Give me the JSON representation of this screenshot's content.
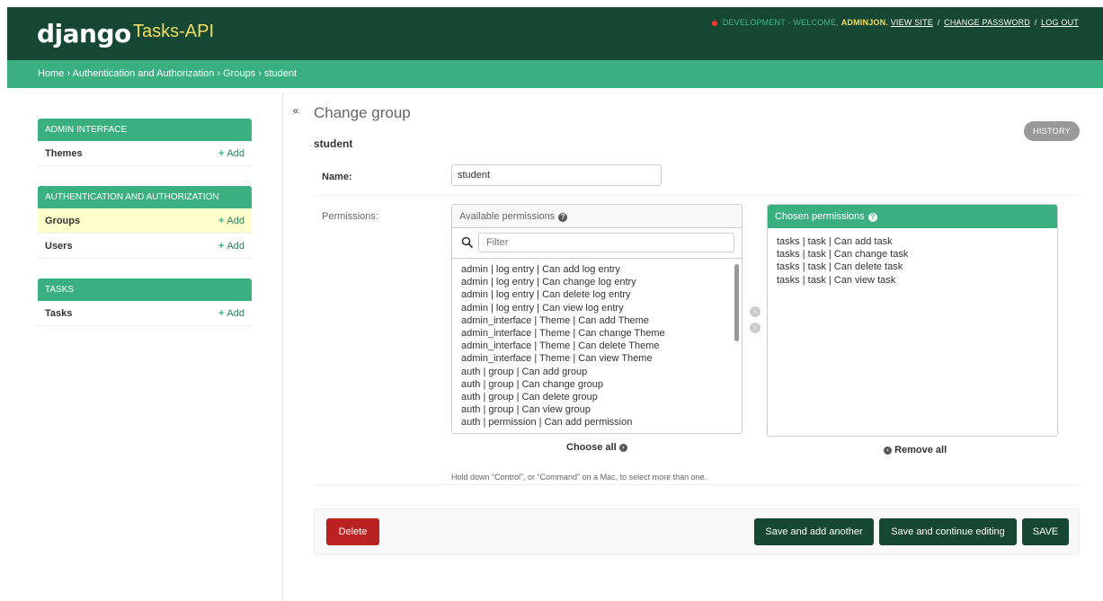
{
  "header": {
    "brand": "django",
    "site_title": "Tasks-API",
    "env_text": "DEVELOPMENT - WELCOME,",
    "username": "ADMINJON.",
    "view_site": "VIEW SITE",
    "change_password": "CHANGE PASSWORD",
    "log_out": "LOG OUT",
    "sep": "/"
  },
  "breadcrumbs": [
    "Home",
    "Authentication and Authorization",
    "Groups",
    "student"
  ],
  "breadcrumb_sep": "›",
  "sidebar": {
    "modules": [
      {
        "caption": "ADMIN INTERFACE",
        "rows": [
          {
            "label": "Themes",
            "add": "Add"
          }
        ]
      },
      {
        "caption": "AUTHENTICATION AND AUTHORIZATION",
        "rows": [
          {
            "label": "Groups",
            "add": "Add"
          },
          {
            "label": "Users",
            "add": "Add"
          }
        ]
      },
      {
        "caption": "TASKS",
        "rows": [
          {
            "label": "Tasks",
            "add": "Add"
          }
        ]
      }
    ],
    "toggle": "«"
  },
  "content": {
    "title": "Change group",
    "object_name": "student",
    "history": "HISTORY",
    "name_label": "Name:",
    "name_value": "student",
    "permissions_label": "Permissions:"
  },
  "selector": {
    "available_title": "Available permissions",
    "chosen_title": "Chosen permissions",
    "filter_placeholder": "Filter",
    "available": [
      "admin | log entry | Can add log entry",
      "admin | log entry | Can change log entry",
      "admin | log entry | Can delete log entry",
      "admin | log entry | Can view log entry",
      "admin_interface | Theme | Can add Theme",
      "admin_interface | Theme | Can change Theme",
      "admin_interface | Theme | Can delete Theme",
      "admin_interface | Theme | Can view Theme",
      "auth | group | Can add group",
      "auth | group | Can change group",
      "auth | group | Can delete group",
      "auth | group | Can view group",
      "auth | permission | Can add permission"
    ],
    "chosen": [
      "tasks | task | Can add task",
      "tasks | task | Can change task",
      "tasks | task | Can delete task",
      "tasks | task | Can view task"
    ],
    "choose_all": "Choose all",
    "remove_all": "Remove all",
    "help_text": "Hold down “Control”, or “Command” on a Mac, to select more than one."
  },
  "actions": {
    "delete": "Delete",
    "save_add_another": "Save and add another",
    "save_continue": "Save and continue editing",
    "save": "SAVE"
  },
  "colors": {
    "header": "#154734",
    "accent": "#3aaf7f",
    "brand_sub": "#f5dd5d",
    "delete": "#ba2121"
  }
}
